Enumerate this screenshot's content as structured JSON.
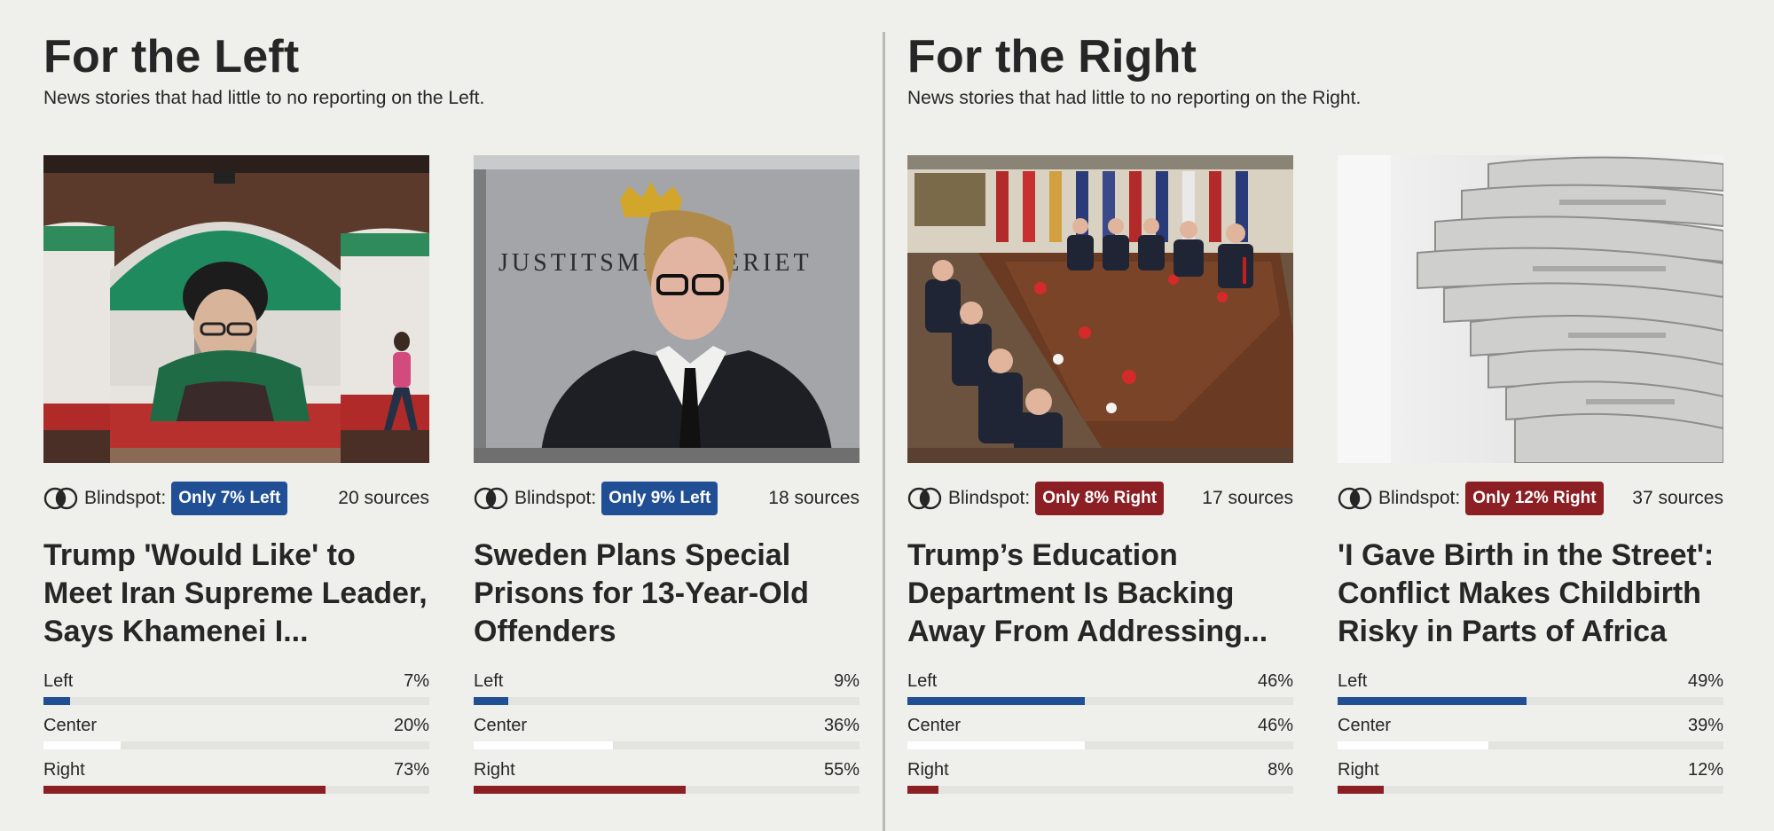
{
  "sections": [
    {
      "title": "For the Left",
      "subtitle": "News stories that had little to no reporting on the Left.",
      "cards": [
        {
          "image_desc": "iran-mural-photo",
          "blindspot_label": "Blindspot:",
          "badge": "Only 7% Left",
          "badge_side": "left",
          "sources": "20 sources",
          "headline": "Trump 'Would Like' to Meet Iran Supreme Leader, Says Khamenei I...",
          "bias": {
            "left": {
              "label": "Left",
              "pct": "7%",
              "value": 7
            },
            "center": {
              "label": "Center",
              "pct": "20%",
              "value": 20
            },
            "right": {
              "label": "Right",
              "pct": "73%",
              "value": 73
            }
          }
        },
        {
          "image_desc": "justice-ministry-speaker-photo",
          "blindspot_label": "Blindspot:",
          "badge": "Only 9% Left",
          "badge_side": "left",
          "sources": "18 sources",
          "headline": "Sweden Plans Special Prisons for 13-Year-Old Offenders",
          "image_text": "JUSTITSMINISTERIET",
          "bias": {
            "left": {
              "label": "Left",
              "pct": "9%",
              "value": 9
            },
            "center": {
              "label": "Center",
              "pct": "36%",
              "value": 36
            },
            "right": {
              "label": "Right",
              "pct": "55%",
              "value": 55
            }
          }
        }
      ]
    },
    {
      "title": "For the Right",
      "subtitle": "News stories that had little to no reporting on the Right.",
      "cards": [
        {
          "image_desc": "cabinet-meeting-photo",
          "blindspot_label": "Blindspot:",
          "badge": "Only 8% Right",
          "badge_side": "right",
          "sources": "17 sources",
          "headline": "Trump’s Education Department Is Backing Away From Addressing...",
          "bias": {
            "left": {
              "label": "Left",
              "pct": "46%",
              "value": 46
            },
            "center": {
              "label": "Center",
              "pct": "46%",
              "value": 46
            },
            "right": {
              "label": "Right",
              "pct": "8%",
              "value": 8
            }
          }
        },
        {
          "image_desc": "newspaper-stack-photo",
          "blindspot_label": "Blindspot:",
          "badge": "Only 12% Right",
          "badge_side": "right",
          "sources": "37 sources",
          "headline": "'I Gave Birth in the Street': Conflict Makes Childbirth Risky in Parts of Africa",
          "bias": {
            "left": {
              "label": "Left",
              "pct": "49%",
              "value": 49
            },
            "center": {
              "label": "Center",
              "pct": "39%",
              "value": 39
            },
            "right": {
              "label": "Right",
              "pct": "12%",
              "value": 12
            }
          }
        }
      ]
    }
  ],
  "colors": {
    "left": "#204f95",
    "center": "#ffffff",
    "right": "#8b1f23",
    "background": "#efefeb"
  }
}
